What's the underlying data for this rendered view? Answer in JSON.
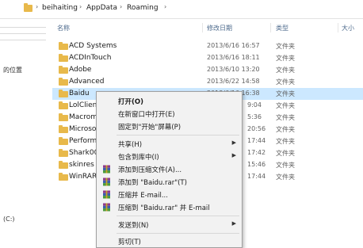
{
  "address": {
    "crumbs": [
      "beihaiting",
      "AppData",
      "Roaming"
    ],
    "separator": "›"
  },
  "columns": {
    "name": "名称",
    "date": "修改日期",
    "type": "类型",
    "size": "大小"
  },
  "nav": {
    "location_label": "的位置",
    "drive_label": "(C:)"
  },
  "files": [
    {
      "name": "ACD Systems",
      "date": "2013/6/16 16:57",
      "type": "文件夹"
    },
    {
      "name": "ACDInTouch",
      "date": "2013/6/16 18:11",
      "type": "文件夹"
    },
    {
      "name": "Adobe",
      "date": "2013/6/10 13:20",
      "type": "文件夹"
    },
    {
      "name": "Advanced",
      "date": "2013/6/22 14:58",
      "type": "文件夹"
    },
    {
      "name": "Baidu",
      "date": "2013/6/16 16:38",
      "type": "文件夹",
      "selected": true
    },
    {
      "name": "LolClient",
      "date": "9:04",
      "type": "文件夹"
    },
    {
      "name": "Macrom",
      "date": "5:36",
      "type": "文件夹"
    },
    {
      "name": "Microso",
      "date": "20:56",
      "type": "文件夹"
    },
    {
      "name": "Perform",
      "date": "17:44",
      "type": "文件夹"
    },
    {
      "name": "Shark007",
      "date": "17:42",
      "type": "文件夹"
    },
    {
      "name": "skinres",
      "date": "15:46",
      "type": "文件夹"
    },
    {
      "name": "WinRAR",
      "date": "17:44",
      "type": "文件夹"
    }
  ],
  "context_menu": {
    "items": [
      {
        "label": "打开(O)",
        "bold": true
      },
      {
        "label": "在新窗口中打开(E)"
      },
      {
        "label": "固定到\"开始\"屏幕(P)"
      },
      {
        "label": "共享(H)",
        "submenu": true
      },
      {
        "label": "包含到库中(I)",
        "submenu": true
      },
      {
        "label": "添加到压缩文件(A)...",
        "icon": "winrar-icon"
      },
      {
        "label": "添加到 \"Baidu.rar\"(T)",
        "icon": "winrar-icon"
      },
      {
        "label": "压缩并 E-mail...",
        "icon": "winrar-icon"
      },
      {
        "label": "压缩到 \"Baidu.rar\" 并 E-mail",
        "icon": "winrar-icon"
      },
      {
        "label": "发送到(N)",
        "submenu": true
      },
      {
        "label": "剪切(T)"
      }
    ],
    "submenu_arrow": "▶"
  },
  "colors": {
    "selection": "#cce8ff",
    "folder": "#e8b94b",
    "header_text": "#4d6a8c",
    "menu_bg": "#f2f2f2"
  }
}
